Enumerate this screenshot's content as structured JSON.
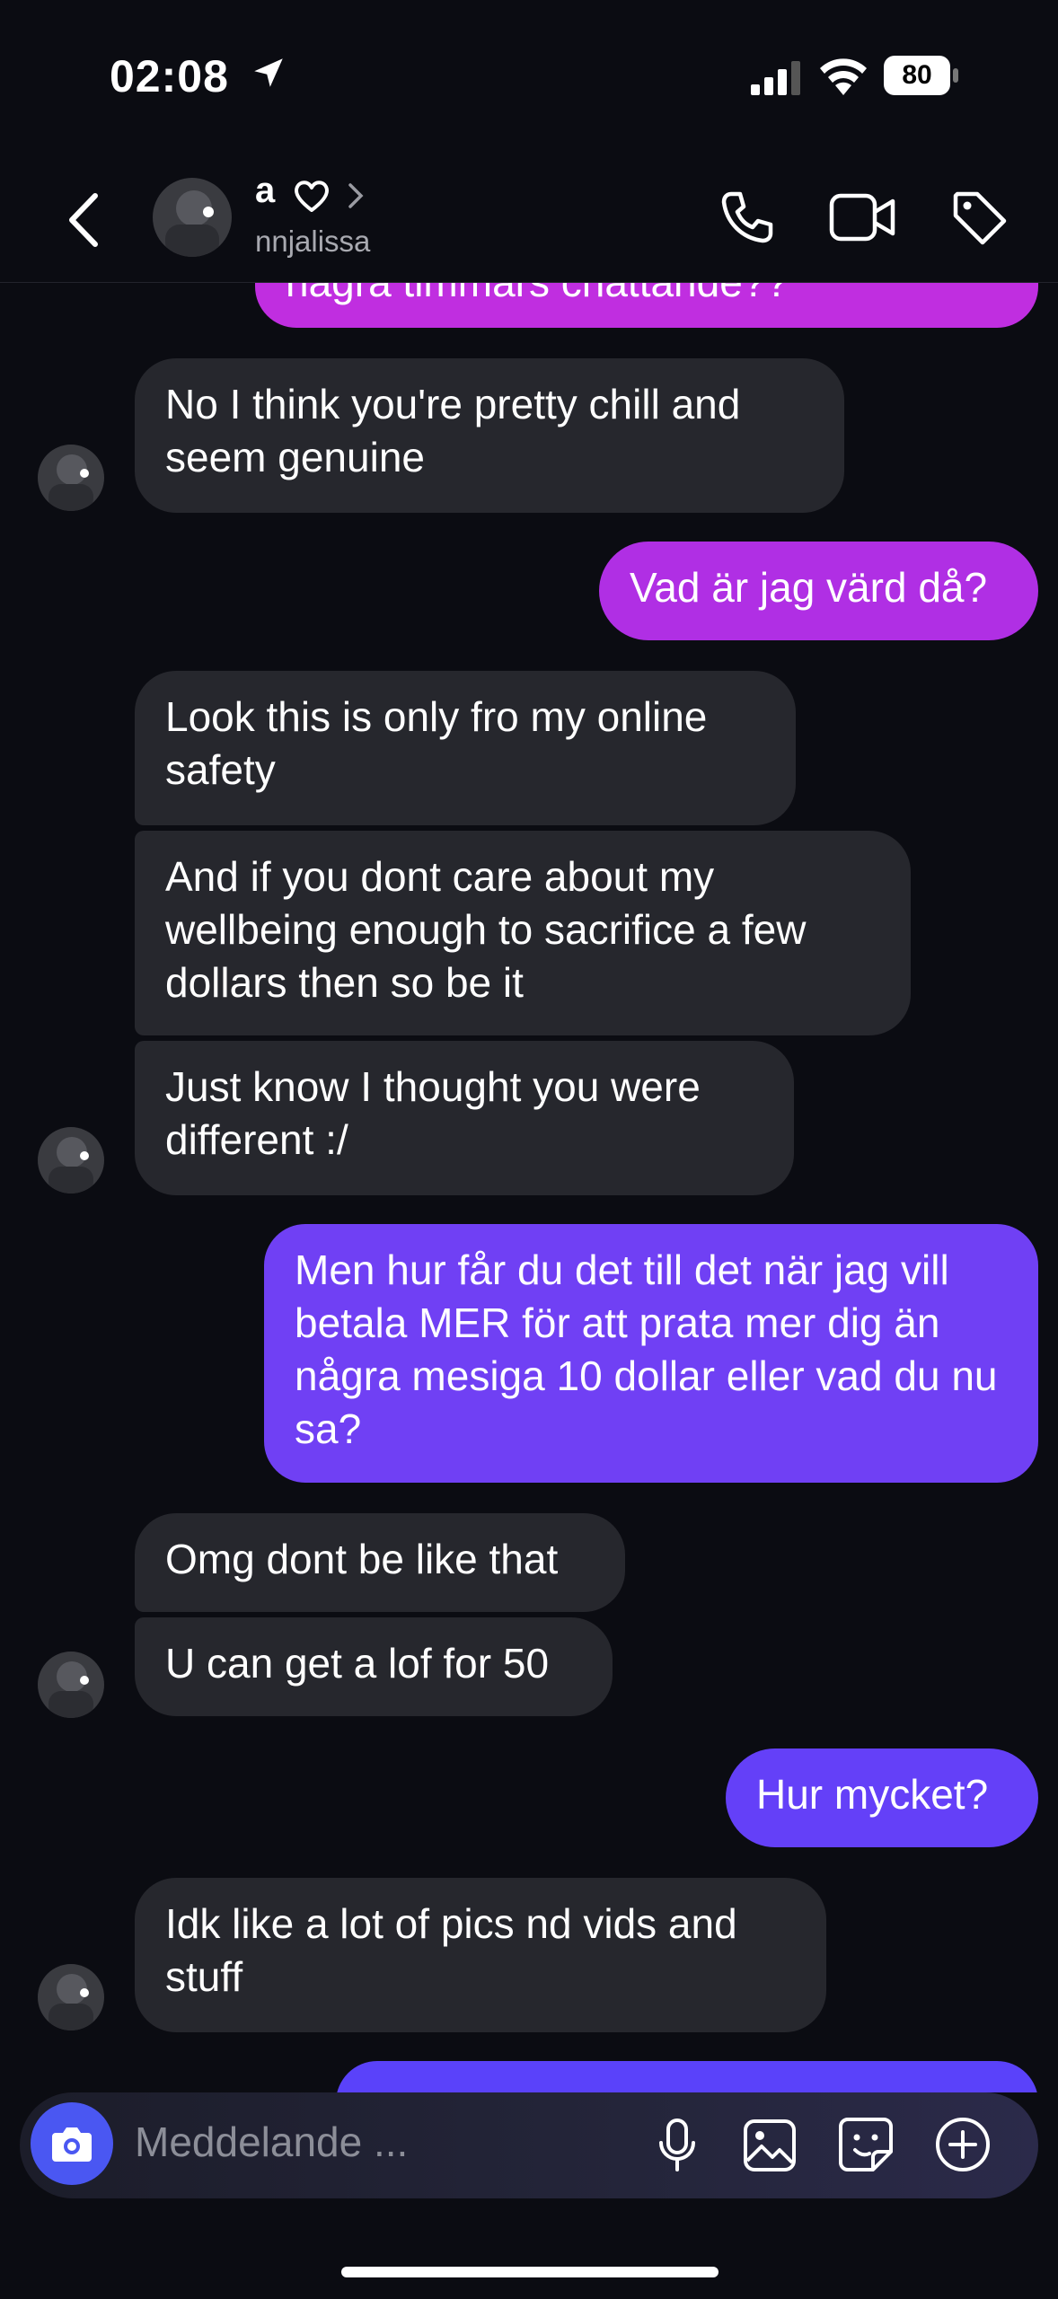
{
  "status_bar": {
    "time": "02:08",
    "battery": "80"
  },
  "header": {
    "name": "a",
    "username": "nnjalissa"
  },
  "messages": [
    {
      "side": "out",
      "text": "några timmars chattande??"
    },
    {
      "side": "in",
      "text": "No I think you're pretty chill and seem genuine"
    },
    {
      "side": "out",
      "text": "Vad är jag värd då?"
    },
    {
      "side": "in",
      "text": "Look this is only fro my online safety"
    },
    {
      "side": "in",
      "text": "And if you dont care about my wellbeing enough to sacrifice a few dollars then so be it"
    },
    {
      "side": "in",
      "text": "Just know I thought you were different :/"
    },
    {
      "side": "out",
      "text": "Men hur får du det till det när jag vill betala MER för att prata mer dig än några mesiga 10 dollar eller vad du nu sa?"
    },
    {
      "side": "in",
      "text": "Omg dont be like that"
    },
    {
      "side": "in",
      "text": "U can get a lof for 50"
    },
    {
      "side": "out",
      "text": "Hur mycket?"
    },
    {
      "side": "in",
      "text": "Idk like a lot of pics nd vids and stuff"
    }
  ],
  "composer": {
    "placeholder": "Meddelande ..."
  },
  "colors": {
    "incoming_bubble": "#26272d",
    "outgoing_top": "#c02ee0",
    "outgoing_bottom": "#6b3cf8",
    "background": "#0b0c12",
    "camera_button": "#4a57f2"
  },
  "icons": [
    "location-arrow-icon",
    "signal-icon",
    "wifi-icon",
    "battery-icon",
    "back-chevron-icon",
    "heart-icon",
    "chevron-right-icon",
    "phone-icon",
    "video-icon",
    "tag-icon",
    "camera-icon",
    "microphone-icon",
    "image-icon",
    "sticker-icon",
    "plus-icon"
  ]
}
